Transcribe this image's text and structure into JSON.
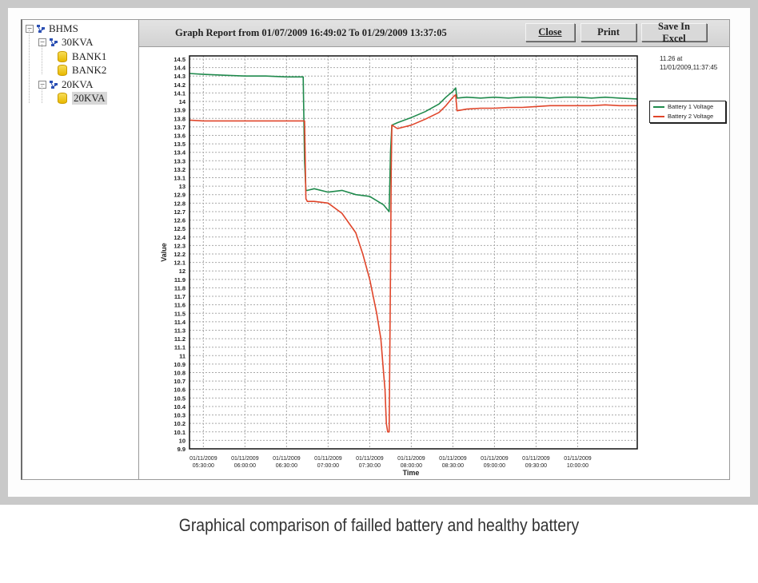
{
  "tree": {
    "nodes": [
      {
        "label": "BHMS",
        "level": 0,
        "type": "group",
        "expanded": true
      },
      {
        "label": "30KVA",
        "level": 1,
        "type": "group",
        "expanded": true
      },
      {
        "label": "BANK1",
        "level": 2,
        "type": "bank"
      },
      {
        "label": "BANK2",
        "level": 2,
        "type": "bank"
      },
      {
        "label": "20KVA",
        "level": 1,
        "type": "group",
        "expanded": true
      },
      {
        "label": "20KVA",
        "level": 2,
        "type": "bank",
        "selected": true
      }
    ],
    "expander_symbol": "−"
  },
  "toolbar": {
    "title": "Graph Report from 01/07/2009 16:49:02 To 01/29/2009 13:37:05",
    "close_label": "Close",
    "print_label": "Print",
    "save_excel_label": "Save In Excel"
  },
  "note": {
    "line1": "11.26 at",
    "line2": "11/01/2009,11:37:45"
  },
  "caption": "Graphical comparison of failled battery and healthy battery",
  "chart_data": {
    "type": "line",
    "title": "",
    "xlabel": "Time",
    "ylabel": "Value",
    "ylim": [
      9.9,
      14.5
    ],
    "ytick_step": 0.1,
    "yticks": [
      "14.5",
      "14.4",
      "14.3",
      "14.2",
      "14.1",
      "14",
      "13.9",
      "13.8",
      "13.7",
      "13.6",
      "13.5",
      "13.4",
      "13.3",
      "13.2",
      "13.1",
      "13",
      "12.9",
      "12.8",
      "12.7",
      "12.6",
      "12.5",
      "12.4",
      "12.3",
      "12.2",
      "12.1",
      "12",
      "11.9",
      "11.8",
      "11.7",
      "11.6",
      "11.5",
      "11.4",
      "11.3",
      "11.2",
      "11.1",
      "11",
      "10.9",
      "10.8",
      "10.7",
      "10.6",
      "10.5",
      "10.4",
      "10.3",
      "10.2",
      "10.1",
      "10",
      "9.9"
    ],
    "xlim_minutes": [
      320,
      643
    ],
    "xticks": [
      {
        "minutes": 330,
        "date": "01/11/2009",
        "time": "05:30:00"
      },
      {
        "minutes": 360,
        "date": "01/11/2009",
        "time": "06:00:00"
      },
      {
        "minutes": 390,
        "date": "01/11/2009",
        "time": "06:30:00"
      },
      {
        "minutes": 420,
        "date": "01/11/2009",
        "time": "07:00:00"
      },
      {
        "minutes": 450,
        "date": "01/11/2009",
        "time": "07:30:00"
      },
      {
        "minutes": 480,
        "date": "01/11/2009",
        "time": "08:00:00"
      },
      {
        "minutes": 510,
        "date": "01/11/2009",
        "time": "08:30:00"
      },
      {
        "minutes": 540,
        "date": "01/11/2009",
        "time": "09:00:00"
      },
      {
        "minutes": 570,
        "date": "01/11/2009",
        "time": "09:30:00"
      },
      {
        "minutes": 600,
        "date": "01/11/2009",
        "time": "10:00:00"
      }
    ],
    "grid": true,
    "legend_position": "right",
    "series": [
      {
        "name": "Battery 1 Voltage",
        "color": "#1f8a4c",
        "x": [
          320,
          330,
          345,
          360,
          375,
          390,
          402,
          403,
          404,
          405,
          410,
          420,
          430,
          440,
          450,
          460,
          464,
          465,
          466,
          470,
          480,
          490,
          500,
          505,
          510,
          512,
          513,
          520,
          530,
          540,
          550,
          560,
          570,
          580,
          590,
          600,
          610,
          620,
          630,
          643
        ],
        "values": [
          14.33,
          14.32,
          14.31,
          14.3,
          14.3,
          14.29,
          14.29,
          13.3,
          12.95,
          12.95,
          12.97,
          12.93,
          12.95,
          12.9,
          12.88,
          12.78,
          12.7,
          13.4,
          13.72,
          13.75,
          13.81,
          13.88,
          13.97,
          14.05,
          14.12,
          14.16,
          14.04,
          14.05,
          14.04,
          14.05,
          14.04,
          14.05,
          14.05,
          14.04,
          14.05,
          14.05,
          14.04,
          14.05,
          14.04,
          14.03
        ]
      },
      {
        "name": "Battery 2 Voltage",
        "color": "#e0452a",
        "x": [
          320,
          330,
          345,
          360,
          375,
          390,
          403,
          404,
          405,
          410,
          420,
          430,
          440,
          445,
          450,
          455,
          458,
          460,
          461,
          462,
          463,
          464,
          465,
          465.5,
          466,
          470,
          480,
          490,
          500,
          505,
          510,
          512,
          513,
          520,
          530,
          540,
          550,
          560,
          570,
          580,
          590,
          600,
          610,
          620,
          630,
          643
        ],
        "values": [
          13.78,
          13.77,
          13.77,
          13.77,
          13.77,
          13.77,
          13.77,
          12.85,
          12.82,
          12.82,
          12.8,
          12.68,
          12.45,
          12.2,
          11.9,
          11.5,
          11.2,
          10.8,
          10.6,
          10.2,
          10.1,
          10.1,
          12.0,
          13.2,
          13.72,
          13.68,
          13.72,
          13.79,
          13.87,
          13.95,
          14.05,
          14.08,
          13.89,
          13.91,
          13.92,
          13.92,
          13.93,
          13.93,
          13.94,
          13.95,
          13.95,
          13.95,
          13.95,
          13.96,
          13.95,
          13.95
        ]
      }
    ]
  }
}
